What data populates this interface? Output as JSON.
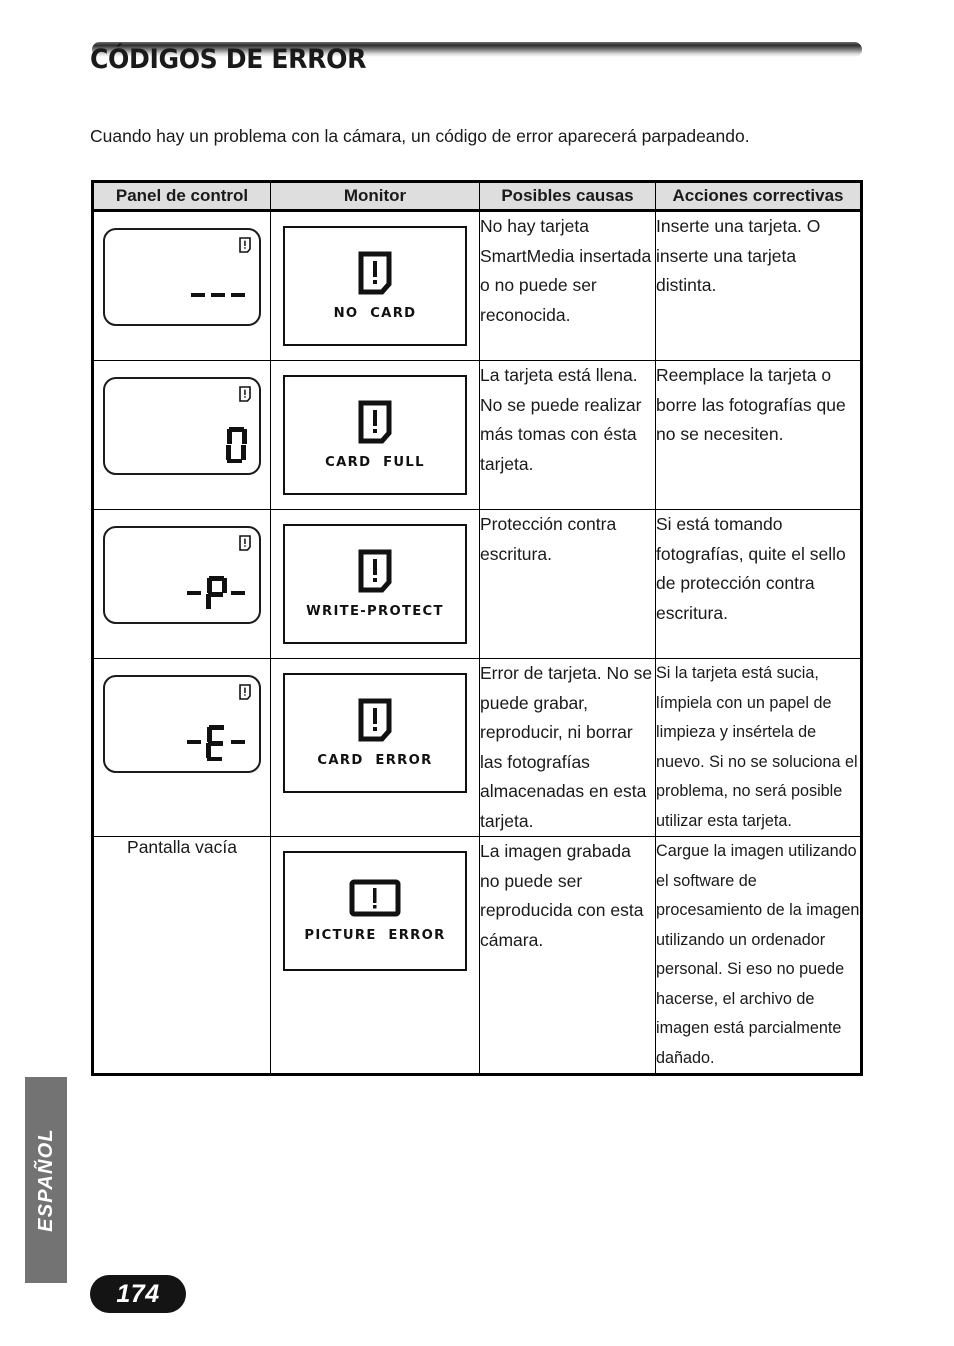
{
  "page": {
    "title": "CÓDIGOS DE ERROR",
    "intro": "Cuando hay un problema con la cámara, un código de error aparecerá parpadeando.",
    "language_tab": "ESPAÑOL",
    "page_number": "174"
  },
  "table": {
    "headers": {
      "panel": "Panel de control",
      "monitor": "Monitor",
      "causes": "Posibles causas",
      "actions": "Acciones correctivas"
    },
    "rows": [
      {
        "panel_display": "- - -",
        "panel_icon": "card-warning-icon",
        "panel_text": "",
        "monitor_icon": "card-warning-icon",
        "monitor_caption": "NO  CARD",
        "causes": "No hay tarjeta SmartMedia insertada o no puede ser reconocida.",
        "actions": "Inserte una tarjeta. O inserte una tarjeta distinta."
      },
      {
        "panel_display": "0",
        "panel_icon": "card-warning-icon",
        "panel_text": "",
        "monitor_icon": "card-warning-icon",
        "monitor_caption": "CARD  FULL",
        "causes": "La tarjeta está llena. No se puede realizar más tomas con ésta tarjeta.",
        "actions": "Reemplace la tarjeta o borre las fotografías que no se necesiten."
      },
      {
        "panel_display": "-P-",
        "panel_icon": "card-warning-icon",
        "panel_text": "",
        "monitor_icon": "card-warning-icon",
        "monitor_caption": "WRITE-PROTECT",
        "causes": "Protección contra escritura.",
        "actions": "Si está tomando fotografías, quite el sello de protección contra escritura."
      },
      {
        "panel_display": "-E-",
        "panel_icon": "card-warning-icon",
        "panel_text": "",
        "monitor_icon": "card-warning-icon",
        "monitor_caption": "CARD  ERROR",
        "causes": "Error de tarjeta. No se puede grabar, reproducir, ni borrar las fotografías almacenadas en esta tarjeta.",
        "actions": "Si la tarjeta está sucia, límpiela con un papel de limpieza y insértela de nuevo. Si no se soluciona el problema, no será posible utilizar esta tarjeta."
      },
      {
        "panel_display": "",
        "panel_icon": "",
        "panel_text": "Pantalla vacía",
        "monitor_icon": "picture-warning-icon",
        "monitor_caption": "PICTURE  ERROR",
        "causes": "La imagen grabada no puede ser reproducida con esta cámara.",
        "actions": "Cargue la imagen utilizando el software de procesamiento de la imagen utilizando un ordenador personal. Si eso no puede hacerse, el archivo de imagen está parcialmente dañado."
      }
    ]
  },
  "colors": {
    "tab_background": "#737373",
    "header_background": "#dedede",
    "pill_background": "#141414",
    "ink": "#1a1a1a"
  }
}
